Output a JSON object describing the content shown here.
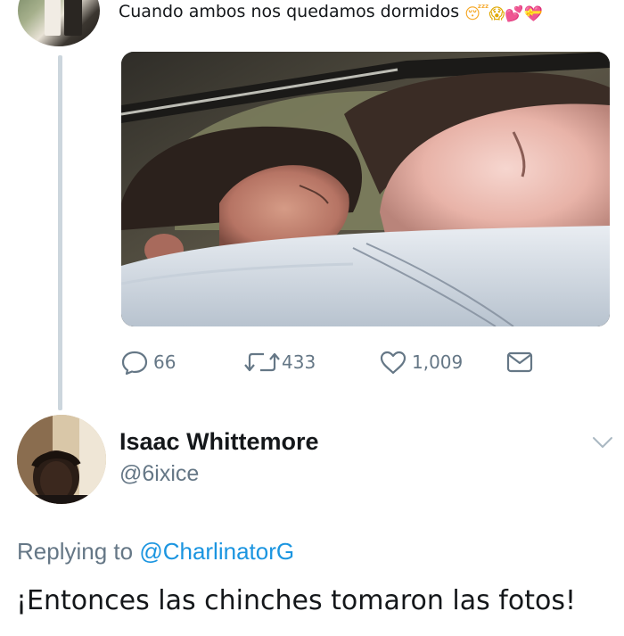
{
  "original_tweet": {
    "text": "Cuando ambos nos quedamos dormidos",
    "emojis": [
      {
        "name": "sleeping-face-icon",
        "glyph": "😴"
      },
      {
        "name": "screaming-face-icon",
        "glyph": "😱"
      },
      {
        "name": "two-hearts-icon",
        "glyph": "💕"
      },
      {
        "name": "heart-with-ribbon-icon",
        "glyph": "💝"
      }
    ],
    "actions": {
      "replies": "66",
      "retweets": "433",
      "likes": "1,009"
    },
    "icons": [
      "reply-icon",
      "retweet-icon",
      "like-icon",
      "message-icon"
    ]
  },
  "reply": {
    "name": "Isaac Whittemore",
    "handle": "@6ixice",
    "replying_label": "Replying to",
    "replying_to": "@CharlinatorG",
    "text": "¡Entonces las chinches tomaron las fotos!"
  },
  "colors": {
    "text": "#14171a",
    "secondary": "#657786",
    "link": "#1b95e0",
    "thread_line": "#ccd6dd"
  }
}
